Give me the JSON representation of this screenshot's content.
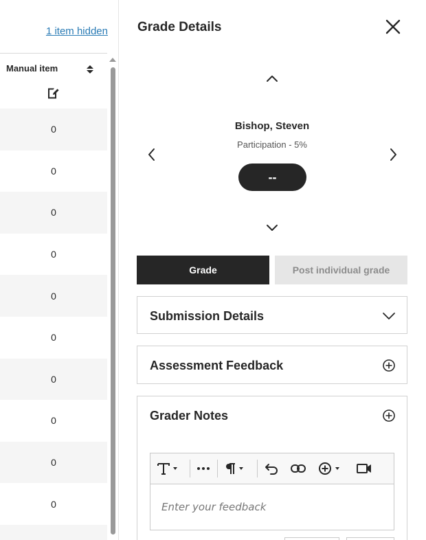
{
  "gradebook": {
    "hidden_link": "1 item hidden",
    "column_header": "Manual item",
    "icons": {
      "sort": "sort-icon",
      "manual": "manual-entry-icon"
    },
    "rows": [
      "0",
      "0",
      "0",
      "0",
      "0",
      "0",
      "0",
      "0",
      "0",
      "0"
    ]
  },
  "panel": {
    "title": "Grade Details",
    "close_icon": "close-icon",
    "student_name": "Bishop, Steven",
    "item_label": "Participation - 5%",
    "grade_value": "--",
    "grade_button": "Grade",
    "post_button": "Post individual grade",
    "sections": {
      "submission": "Submission Details",
      "assessment": "Assessment Feedback",
      "notes": "Grader Notes"
    },
    "editor": {
      "placeholder": "Enter your feedback"
    }
  },
  "colors": {
    "primary": "#262626",
    "link": "#2a7bb5",
    "disabled_bg": "#e6e6e6",
    "row_alt": "#f5f5f5"
  }
}
